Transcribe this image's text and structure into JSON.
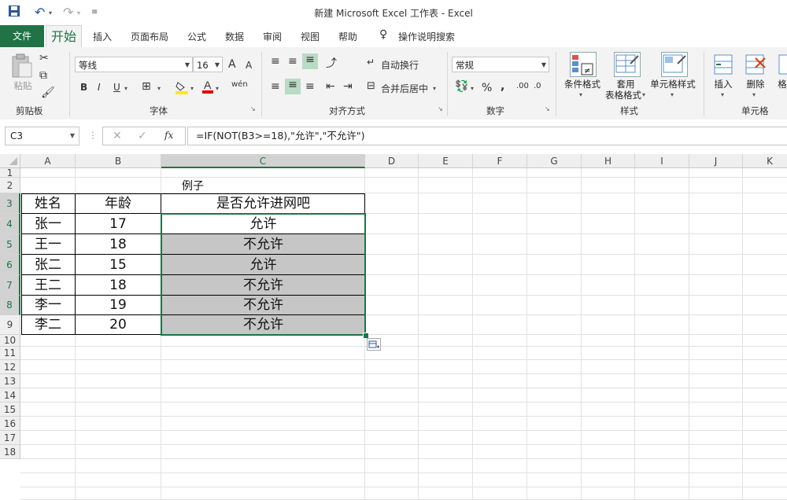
{
  "window": {
    "title": "新建 Microsoft Excel 工作表  -   Excel",
    "qat": {
      "save_icon": "save-icon",
      "undo_icon": "undo-icon",
      "redo_icon": "redo-icon"
    }
  },
  "ribbon_tabs": [
    "文件",
    "开始",
    "插入",
    "页面布局",
    "公式",
    "数据",
    "审阅",
    "视图",
    "帮助",
    "操作说明搜索"
  ],
  "ribbon": {
    "clipboard": {
      "paste": "粘贴",
      "label": "剪贴板"
    },
    "font": {
      "family": "等线",
      "size": "16",
      "bold": "B",
      "italic": "I",
      "underline": "U",
      "grow": "A",
      "shrink": "A",
      "wen": "wén",
      "label": "字体"
    },
    "alignment": {
      "wrap": "自动换行",
      "merge": "合并后居中",
      "label": "对齐方式"
    },
    "number": {
      "format": "常规",
      "percent": "%",
      "comma": ",",
      "label": "数字"
    },
    "styles": {
      "conditional": "条件格式",
      "table_line1": "套用",
      "table_line2": "表格格式",
      "cell_styles": "单元格样式",
      "label": "样式"
    },
    "cells": {
      "insert": "插入",
      "delete": "删除",
      "format": "格",
      "label": "单元格"
    }
  },
  "formula_bar": {
    "name_box": "C3",
    "fx": "fx",
    "formula": "=IF(NOT(B3>=18),\"允许\",\"不允许\")"
  },
  "columns": [
    "A",
    "B",
    "C",
    "D",
    "E",
    "F",
    "G",
    "H",
    "I",
    "J",
    "K"
  ],
  "rows": [
    "1",
    "2",
    "3",
    "4",
    "5",
    "6",
    "7",
    "8",
    "9",
    "10",
    "11",
    "12",
    "13",
    "14",
    "15",
    "16",
    "17",
    "18"
  ],
  "sheet": {
    "c1": "例子",
    "headers": [
      "姓名",
      "年龄",
      "是否允许进网吧"
    ],
    "data": [
      [
        "张一",
        "17",
        "允许"
      ],
      [
        "王一",
        "18",
        "不允许"
      ],
      [
        "张二",
        "15",
        "允许"
      ],
      [
        "王二",
        "18",
        "不允许"
      ],
      [
        "李一",
        "19",
        "不允许"
      ],
      [
        "李二",
        "20",
        "不允许"
      ]
    ]
  },
  "colors": {
    "excel_green": "#217346",
    "selection_fill": "#c6c6c6",
    "selection_border": "#217346"
  }
}
